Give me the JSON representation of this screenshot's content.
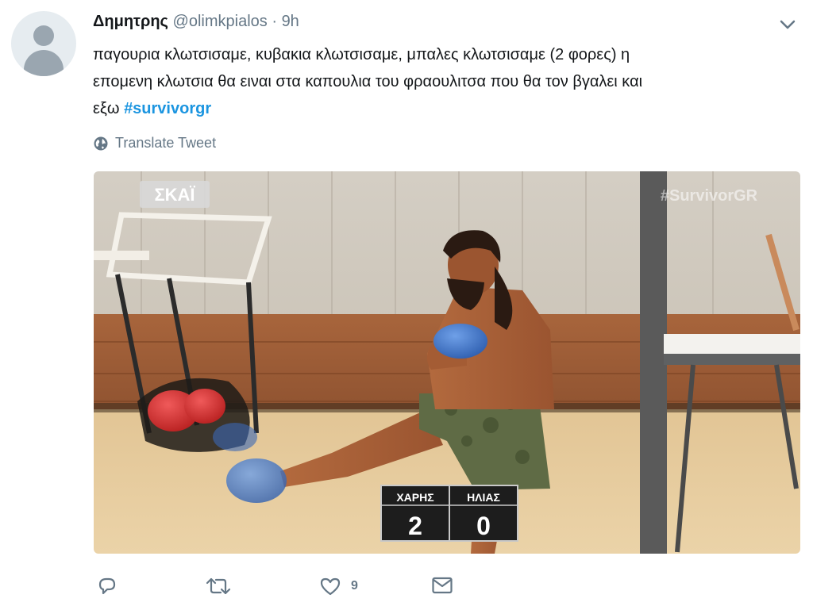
{
  "tweet": {
    "author_name": "Δημητρης",
    "handle": "@olimkpialos",
    "separator": "·",
    "time": "9h",
    "text_lines": [
      "παγουρια κλωτσισαμε, κυβακια κλωτσισαμε, μπαλες κλωτσισαμε (2 φορες) η",
      "επομενη κλωτσια θα ειναι στα καπουλια του φραουλιτσα που θα τον βγαλει και",
      "εξω"
    ],
    "hashtag": "#survivorgr",
    "translate_label": "Translate Tweet"
  },
  "media": {
    "channel_logo": "ΣΚΑΪ",
    "watermark": "#SurvivorGR",
    "scoreboard": {
      "left_name": "ΧΑΡΗΣ",
      "left_score": "2",
      "right_name": "ΗΛΙΑΣ",
      "right_score": "0"
    }
  },
  "actions": {
    "reply_icon": "reply-icon",
    "retweet_icon": "retweet-icon",
    "like_icon": "heart-icon",
    "like_count": "9",
    "dm_icon": "envelope-icon"
  },
  "colors": {
    "link": "#1b95e0",
    "secondary_text": "#657786",
    "primary_text": "#14171a"
  }
}
